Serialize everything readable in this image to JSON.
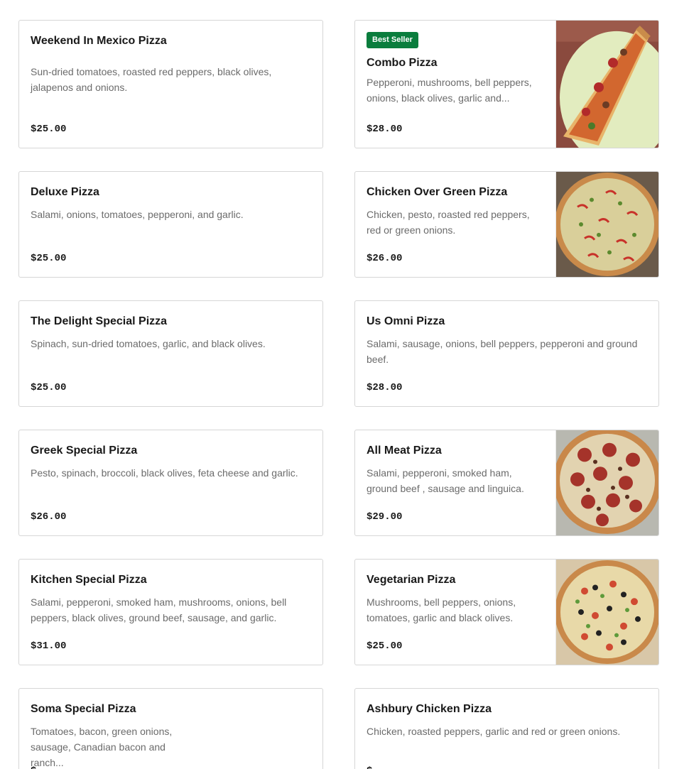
{
  "menu_items": [
    {
      "name": "Weekend In Mexico Pizza",
      "description": "Sun-dried tomatoes, roasted red peppers, black olives, jalapenos and onions.",
      "price": "$25.00"
    },
    {
      "badge": "Best Seller",
      "name": "Combo Pizza",
      "description": "Pepperoni, mushrooms, bell peppers, onions, black olives, garlic and...",
      "price": "$28.00",
      "image": "pizza-slice-photo"
    },
    {
      "name": "Deluxe Pizza",
      "description": "Salami, onions, tomatoes, pepperoni, and garlic.",
      "price": "$25.00"
    },
    {
      "name": "Chicken Over Green Pizza",
      "description": "Chicken, pesto, roasted red peppers, red or green onions.",
      "price": "$26.00",
      "image": "green-pizza-photo"
    },
    {
      "name": "The Delight Special Pizza",
      "description": "Spinach, sun-dried tomatoes, garlic, and black olives.",
      "price": "$25.00"
    },
    {
      "name": "Us Omni Pizza",
      "description": "Salami, sausage, onions, bell peppers, pepperoni and ground beef.",
      "price": "$28.00"
    },
    {
      "name": "Greek Special Pizza",
      "description": "Pesto, spinach, broccoli, black olives, feta cheese and garlic.",
      "price": "$26.00"
    },
    {
      "name": "All Meat Pizza",
      "description": "Salami, pepperoni, smoked ham, ground beef , sausage and linguica.",
      "price": "$29.00",
      "image": "meat-pizza-photo"
    },
    {
      "name": "Kitchen Special Pizza",
      "description": "Salami, pepperoni, smoked ham, mushrooms, onions, bell peppers, black olives, ground beef, sausage, and garlic.",
      "price": "$31.00"
    },
    {
      "name": "Vegetarian Pizza",
      "description": "Mushrooms, bell peppers, onions, tomatoes, garlic and black olives.",
      "price": "$25.00",
      "image": "veggie-pizza-photo"
    },
    {
      "name": "Soma Special Pizza",
      "description": "Tomatoes, bacon, green onions, sausage, Canadian bacon and ranch...",
      "price": "$"
    },
    {
      "name": "Ashbury Chicken Pizza",
      "description": "Chicken, roasted peppers, garlic and red or green onions.",
      "price": "$"
    }
  ],
  "colors": {
    "badge_bg": "#0a7d3d",
    "border": "#d6d6d6",
    "desc_text": "#6b6b6b"
  }
}
